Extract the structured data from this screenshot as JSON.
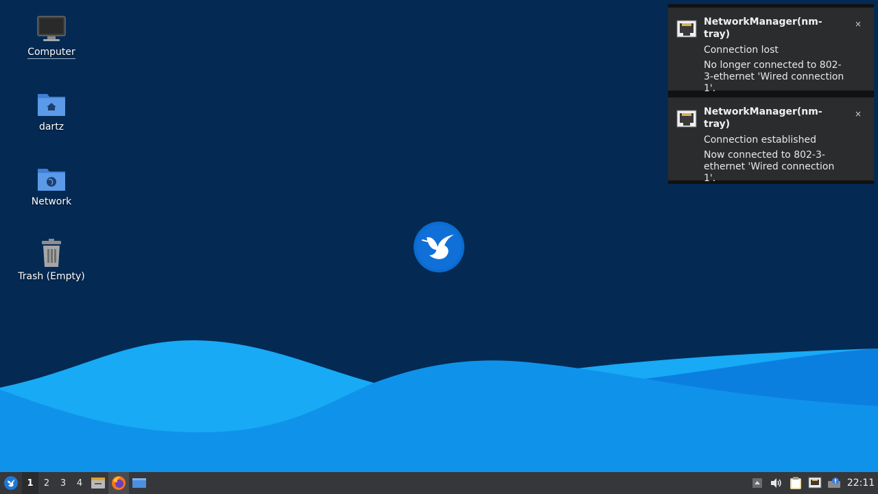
{
  "desktop": {
    "icons": [
      {
        "label": "Computer",
        "icon": "computer-icon"
      },
      {
        "label": "dartz",
        "icon": "home-folder-icon"
      },
      {
        "label": "Network",
        "icon": "network-folder-icon"
      },
      {
        "label": "Trash (Empty)",
        "icon": "trash-icon"
      }
    ],
    "center_logo": "hummingbird-logo"
  },
  "notifications": [
    {
      "app": "NetworkManager(nm-tray)",
      "summary": "Connection lost",
      "body": "No longer connected to 802-3-ethernet 'Wired connection 1'.",
      "close": "×",
      "icon": "ethernet-icon"
    },
    {
      "app": "NetworkManager(nm-tray)",
      "summary": "Connection established",
      "body": "Now connected to 802-3-ethernet 'Wired connection 1'.",
      "close": "×",
      "icon": "ethernet-icon"
    }
  ],
  "taskbar": {
    "workspaces": [
      "1",
      "2",
      "3",
      "4"
    ],
    "active_workspace": "1",
    "launchers": [
      "file-manager-icon",
      "firefox-icon",
      "show-desktop-icon"
    ],
    "tray": [
      "tray-expand-icon",
      "volume-icon",
      "clipboard-icon",
      "network-tray-icon",
      "updates-icon"
    ],
    "clock": "22:11"
  },
  "colors": {
    "background": "#042a53",
    "wave_light": "#17a8f5",
    "wave_mid": "#0e8fe8",
    "wave_dark": "#0a6fd6",
    "notification_bg": "#2b2c2e",
    "taskbar_bg": "#36373a"
  }
}
